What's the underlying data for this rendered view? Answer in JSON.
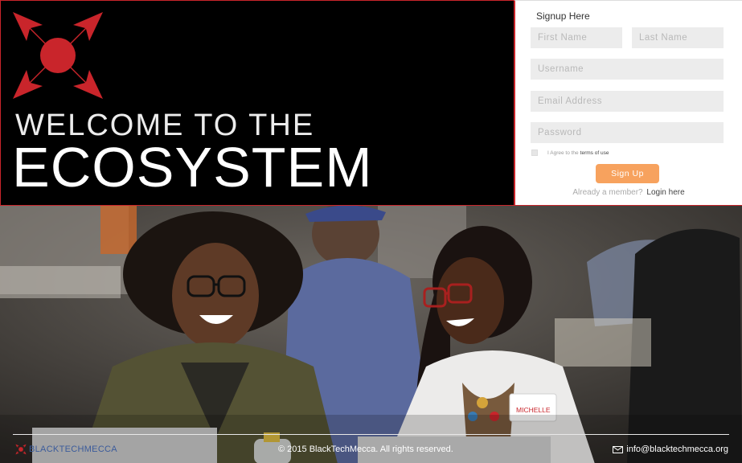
{
  "hero": {
    "welcome": "WELCOME TO THE",
    "headline": "ECOSYSTEM"
  },
  "signup": {
    "title": "Signup Here",
    "first_name_placeholder": "First Name",
    "last_name_placeholder": "Last Name",
    "username_placeholder": "Username",
    "email_placeholder": "Email Address",
    "password_placeholder": "Password",
    "agree_text": "I Agree to the",
    "terms_link": "terms of use",
    "button_label": "Sign Up",
    "member_text": "Already a member?",
    "login_link": "Login here"
  },
  "photo": {
    "badge_name": "MICHELLE"
  },
  "footer": {
    "brand": "BLACKTECHMECCA",
    "copyright": "© 2015 BlackTechMecca. All rights reserved.",
    "email": "info@blacktechmecca.org"
  },
  "colors": {
    "brand_red": "#c9252b",
    "signup_button": "#f7a25e",
    "footer_brand": "#3b5b9b"
  },
  "icons": [
    "logo-icon",
    "mail-icon",
    "footer-logo-icon"
  ]
}
